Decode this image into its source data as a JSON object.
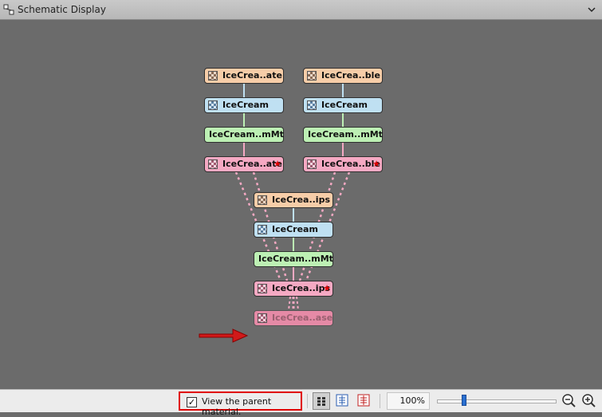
{
  "window": {
    "title": "Schematic Display",
    "title_icon": "schematic-icon",
    "menu_icon": "chevron-down-icon"
  },
  "nodes": {
    "left_top": "IceCrea..ate",
    "left_base": "IceCream",
    "left_mtl": "IceCream..mMt",
    "left_composite": "IceCrea..ate",
    "right_top": "IceCrea..ble",
    "right_base": "IceCream",
    "right_mtl": "IceCream..mMt",
    "right_composite": "IceCrea..ble",
    "mid_top": "IceCrea..ips",
    "mid_base": "IceCream",
    "mid_mtl": "IceCream..mMt",
    "mid_composite": "IceCrea..ips",
    "parent": "IceCrea..ase",
    "star_glyph": "★"
  },
  "statusbar": {
    "checkbox_label": "View the parent material.",
    "checkbox_checked": "✓",
    "zoom_value": "100%",
    "view_buttons": [
      "list-view-icon",
      "tree-view-icon",
      "red-tree-view-icon"
    ],
    "zoom_buttons": [
      "zoom-out-icon",
      "zoom-in-icon"
    ]
  },
  "colors": {
    "peach": "#f7cda8",
    "blue": "#bfe0f2",
    "green": "#bdf0b4",
    "pink": "#f5a9c3",
    "highlight_red": "#e00000",
    "canvas": "#6b6b6b"
  }
}
